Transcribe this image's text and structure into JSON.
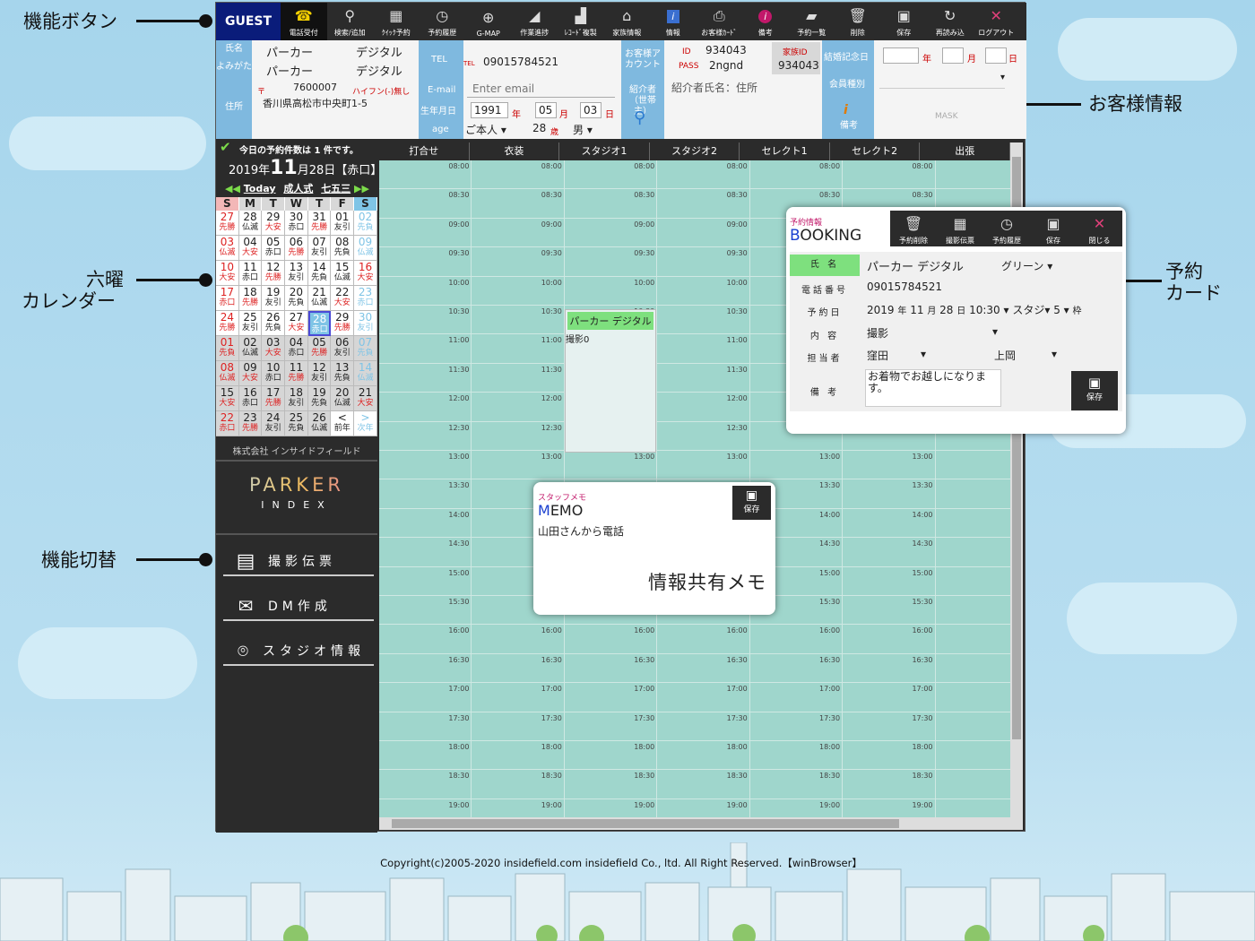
{
  "annotations": {
    "function_buttons": "機能ボタン",
    "customer_info": "お客様情報",
    "rokuyo_calendar_1": "六曜",
    "rokuyo_calendar_2": "カレンダー",
    "booking_card_1": "予約",
    "booking_card_2": "カード",
    "function_switch": "機能切替"
  },
  "toolbar": {
    "guest": "GUEST",
    "buttons": [
      {
        "label": "電話受付",
        "icon": "phone-icon"
      },
      {
        "label": "検索/追加",
        "icon": "search-icon"
      },
      {
        "label": "ｸｲｯｸ予約",
        "icon": "calendar-icon"
      },
      {
        "label": "予約履歴",
        "icon": "history-icon"
      },
      {
        "label": "G-MAP",
        "icon": "map-icon"
      },
      {
        "label": "作業進捗",
        "icon": "progress-icon"
      },
      {
        "label": "ﾚｺｰﾄﾞ複製",
        "icon": "duplicate-icon"
      },
      {
        "label": "家族情報",
        "icon": "family-icon"
      },
      {
        "label": "情報",
        "icon": "info-icon"
      },
      {
        "label": "お客様ｶｰﾄﾞ",
        "icon": "printer-icon"
      },
      {
        "label": "備考",
        "icon": "note-icon"
      },
      {
        "label": "予約一覧",
        "icon": "folder-icon"
      },
      {
        "label": "削除",
        "icon": "trash-icon"
      },
      {
        "label": "保存",
        "icon": "save-icon"
      },
      {
        "label": "再読み込",
        "icon": "reload-icon"
      },
      {
        "label": "ログアウト",
        "icon": "close-icon"
      }
    ]
  },
  "customer": {
    "name_label": "氏名",
    "kana_label": "よみがた",
    "address_label": "住所",
    "last_name": "パーカー",
    "first_name": "デジタル",
    "last_kana": "パーカー",
    "first_kana": "デジタル",
    "zip_mark": "〒",
    "zip": "7600007",
    "zip_hint": "ハイフン(-)無し",
    "address": "香川県高松市中央町1-5",
    "tel_label": "TEL",
    "email_label": "E-mail",
    "birth_label": "生年月日",
    "age_label": "age",
    "tel_mark": "TEL",
    "tel": "09015784521",
    "email_placeholder": "Enter email",
    "birth_year": "1991",
    "year_unit": "年",
    "birth_month": "05",
    "month_unit": "月",
    "birth_day": "03",
    "day_unit": "日",
    "relation": "ご本人",
    "age": "28",
    "age_unit": "歳",
    "gender": "男",
    "account_label": "お客様アカウント",
    "referrer_label": "紹介者（世帯主）",
    "id_label": "ID",
    "id": "934043",
    "pass_label": "PASS",
    "pass": "2ngnd",
    "family_id_label": "家族ID",
    "family_id": "934043",
    "referrer_placeholder": "紹介者氏名：住所",
    "anniversary_label": "結婚記念日",
    "member_type_label": "会員種別",
    "note_label": "備考",
    "anniv_year_unit": "年",
    "anniv_month_unit": "月",
    "anniv_day_unit": "日",
    "mask": "MASK"
  },
  "sidebar": {
    "today_count": "今日の予約件数は 1 件です。",
    "date_prefix": "2019年",
    "date_month": "11",
    "date_suffix": "月28日【赤口】",
    "nav_today": "Today",
    "nav_seijin": "成人式",
    "nav_shichigosan": "七五三",
    "weekdays": [
      "S",
      "M",
      "T",
      "W",
      "T",
      "F",
      "S"
    ],
    "company": "株式会社 インサイドフィールド",
    "logo": "PARKER",
    "logo_sub": "INDEX",
    "menu": [
      {
        "label": "撮影伝票",
        "icon": "document-icon"
      },
      {
        "label": "DM作成",
        "icon": "mail-icon"
      },
      {
        "label": "スタジオ情報",
        "icon": "camera-icon"
      }
    ],
    "calendar": [
      [
        [
          "27",
          "先勝",
          "r"
        ],
        [
          "28",
          "仏滅",
          "m"
        ],
        [
          "29",
          "大安",
          "m"
        ],
        [
          "30",
          "赤口",
          "m"
        ],
        [
          "31",
          "先勝",
          "m"
        ],
        [
          "01",
          "友引",
          "b"
        ],
        [
          "02",
          "先負",
          "lb"
        ]
      ],
      [
        [
          "03",
          "仏滅",
          "r"
        ],
        [
          "04",
          "大安",
          "b"
        ],
        [
          "05",
          "赤口",
          "b"
        ],
        [
          "06",
          "先勝",
          "b"
        ],
        [
          "07",
          "友引",
          "b"
        ],
        [
          "08",
          "先負",
          "b"
        ],
        [
          "09",
          "仏滅",
          "lb"
        ]
      ],
      [
        [
          "10",
          "大安",
          "r"
        ],
        [
          "11",
          "赤口",
          "b"
        ],
        [
          "12",
          "先勝",
          "b"
        ],
        [
          "13",
          "友引",
          "b"
        ],
        [
          "14",
          "先負",
          "b"
        ],
        [
          "15",
          "仏滅",
          "b"
        ],
        [
          "16",
          "大安",
          "rs"
        ]
      ],
      [
        [
          "17",
          "赤口",
          "r"
        ],
        [
          "18",
          "先勝",
          "b"
        ],
        [
          "19",
          "友引",
          "b"
        ],
        [
          "20",
          "先負",
          "b"
        ],
        [
          "21",
          "仏滅",
          "b"
        ],
        [
          "22",
          "大安",
          "b"
        ],
        [
          "23",
          "赤口",
          "lb"
        ]
      ],
      [
        [
          "24",
          "先勝",
          "r"
        ],
        [
          "25",
          "友引",
          "b"
        ],
        [
          "26",
          "先負",
          "b"
        ],
        [
          "27",
          "大安",
          "b"
        ],
        [
          "28",
          "赤口",
          "t"
        ],
        [
          "29",
          "先勝",
          "b"
        ],
        [
          "30",
          "友引",
          "lb"
        ]
      ],
      [
        [
          "01",
          "先負",
          "rn"
        ],
        [
          "02",
          "仏滅",
          "n"
        ],
        [
          "03",
          "大安",
          "n"
        ],
        [
          "04",
          "赤口",
          "n"
        ],
        [
          "05",
          "先勝",
          "n"
        ],
        [
          "06",
          "友引",
          "n"
        ],
        [
          "07",
          "先負",
          "lbn"
        ]
      ],
      [
        [
          "08",
          "仏滅",
          "rn"
        ],
        [
          "09",
          "大安",
          "n"
        ],
        [
          "10",
          "赤口",
          "n"
        ],
        [
          "11",
          "先勝",
          "n"
        ],
        [
          "12",
          "友引",
          "n"
        ],
        [
          "13",
          "先負",
          "n"
        ],
        [
          "14",
          "仏滅",
          "lbn"
        ]
      ],
      [
        [
          "15",
          "大安",
          "n"
        ],
        [
          "16",
          "赤口",
          "n"
        ],
        [
          "17",
          "先勝",
          "n"
        ],
        [
          "18",
          "友引",
          "n"
        ],
        [
          "19",
          "先負",
          "n"
        ],
        [
          "20",
          "仏滅",
          "n"
        ],
        [
          "21",
          "大安",
          "n"
        ]
      ],
      [
        [
          "22",
          "赤口",
          "rn"
        ],
        [
          "23",
          "先勝",
          "n"
        ],
        [
          "24",
          "友引",
          "n"
        ],
        [
          "25",
          "先負",
          "n"
        ],
        [
          "26",
          "仏滅",
          "n"
        ],
        [
          "<",
          "前年",
          "w"
        ],
        [
          ">",
          "次年",
          "lbw"
        ]
      ]
    ]
  },
  "schedule": {
    "columns": [
      "打合せ",
      "衣装",
      "スタジオ1",
      "スタジオ2",
      "セレクト1",
      "セレクト2",
      "出張"
    ],
    "times": [
      "08:00",
      "08:30",
      "09:00",
      "09:30",
      "10:00",
      "10:30",
      "11:00",
      "11:30",
      "12:00",
      "12:30",
      "13:00",
      "13:30",
      "14:00",
      "14:30",
      "15:00",
      "15:30",
      "16:00",
      "16:30",
      "17:00",
      "17:30",
      "18:00",
      "18:30",
      "19:00"
    ],
    "booking_name": "パーカー デジタル",
    "booking_content": "撮影0"
  },
  "booking_card": {
    "subtitle": "予約情報",
    "title_initial": "B",
    "title_rest": "OOKING",
    "actions": [
      {
        "label": "予約削除",
        "icon": "trash-icon"
      },
      {
        "label": "撮影伝票",
        "icon": "document-icon"
      },
      {
        "label": "予約履歴",
        "icon": "history-icon"
      },
      {
        "label": "保存",
        "icon": "save-icon"
      },
      {
        "label": "閉じる",
        "icon": "close-icon"
      }
    ],
    "name_label": "氏 名",
    "name": "パーカー デジタル",
    "color": "グリーン",
    "phone_label": "電話番号",
    "phone": "09015784521",
    "date_label": "予約日",
    "year": "2019",
    "year_unit": "年",
    "month": "11",
    "month_unit": "月",
    "day": "28",
    "day_unit": "日",
    "time": "10:30",
    "studio": "スタジ",
    "slots": "5",
    "slots_unit": "枠",
    "content_label": "内 容",
    "content": "撮影",
    "staff_label": "担当者",
    "staff1": "窪田",
    "staff2": "上岡",
    "note_label": "備 考",
    "note": "お着物でお越しになります。",
    "save": "保存"
  },
  "memo": {
    "subtitle": "スタッフメモ",
    "title_initial": "M",
    "title_rest": "EMO",
    "save": "保存",
    "text": "山田さんから電話",
    "caption": "情報共有メモ"
  },
  "footer": {
    "copyright": "Copyright(c)2005-2020 insidefield.com insidefield Co., ltd. All Right Reserved.【winBrowser】"
  }
}
